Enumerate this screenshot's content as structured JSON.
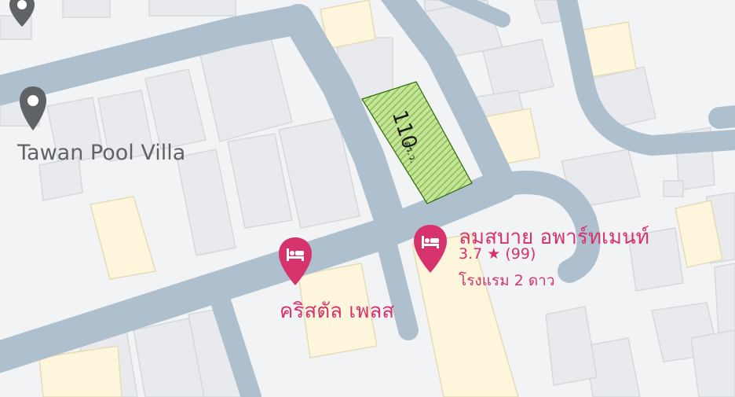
{
  "map": {
    "places": [
      {
        "name": "Tawan Pool Villa",
        "kind": "place",
        "icon": "map-pin-icon"
      },
      {
        "name": "คริสตัล เพลส",
        "kind": "hotel",
        "icon": "hotel-bed-icon"
      },
      {
        "name": "ลมสบาย อพาร์ทเมนท์",
        "kind": "hotel",
        "icon": "hotel-bed-icon",
        "rating": "3.7",
        "rating_star": "★",
        "reviews": "(99)",
        "category": "โรงแรม 2 ดาว"
      }
    ],
    "parcel": {
      "size": "110",
      "unit": "ตร.ว."
    },
    "colors": {
      "road": "#aebfcd",
      "land": "#f1f3f4",
      "building": "#e8eaed",
      "building_edge": "#d6d9dc",
      "yellow_building": "#fdf6dc",
      "parcel_fill": "#c5e39a",
      "parcel_stripe": "#7dbb3c",
      "hotel_pink": "#d6336c",
      "gray_pin": "#5f6368"
    }
  }
}
